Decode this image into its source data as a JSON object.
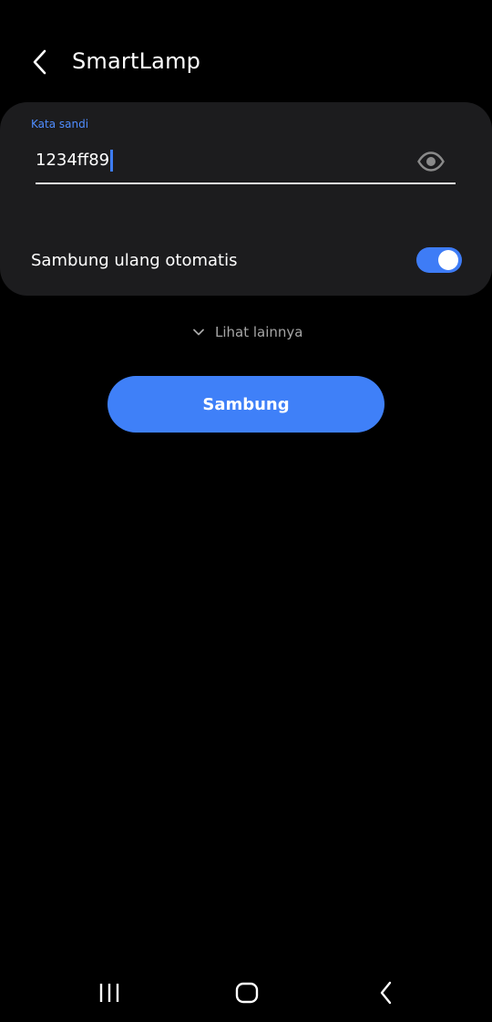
{
  "header": {
    "title": "SmartLamp",
    "back_icon": "chevron-left-icon"
  },
  "password": {
    "label": "Kata sandi",
    "value": "1234ff89",
    "visibility_icon": "eye-icon"
  },
  "auto_reconnect": {
    "label": "Sambung ulang otomatis",
    "enabled": true
  },
  "more_options": {
    "label": "Lihat lainnya",
    "icon": "chevron-down-icon"
  },
  "connect_button": {
    "label": "Sambung"
  },
  "nav_bar": {
    "items": [
      "recent-apps-icon",
      "home-icon",
      "back-icon"
    ]
  },
  "colors": {
    "accent": "#3f80f8",
    "label_accent": "#4f8dff",
    "card_bg": "#1c1c1e",
    "background": "#000000"
  }
}
